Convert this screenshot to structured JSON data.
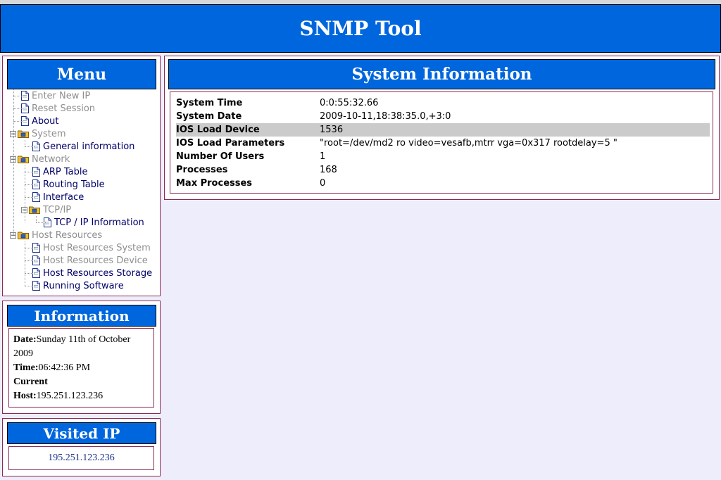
{
  "header": {
    "title": "SNMP Tool"
  },
  "menu": {
    "title": "Menu",
    "items": [
      {
        "label": "Enter New IP",
        "type": "doc",
        "depth": 0,
        "muted": true
      },
      {
        "label": "Reset Session",
        "type": "doc",
        "depth": 0,
        "muted": true
      },
      {
        "label": "About",
        "type": "doc",
        "depth": 0,
        "muted": false
      },
      {
        "label": "System",
        "type": "folder",
        "depth": 0,
        "muted": true
      },
      {
        "label": "General information",
        "type": "doc",
        "depth": 1,
        "muted": false
      },
      {
        "label": "Network",
        "type": "folder",
        "depth": 0,
        "muted": true
      },
      {
        "label": "ARP Table",
        "type": "doc",
        "depth": 1,
        "muted": false
      },
      {
        "label": "Routing Table",
        "type": "doc",
        "depth": 1,
        "muted": false
      },
      {
        "label": "Interface",
        "type": "doc",
        "depth": 1,
        "muted": false
      },
      {
        "label": "TCP/IP",
        "type": "folder",
        "depth": 1,
        "muted": true
      },
      {
        "label": "TCP / IP Information",
        "type": "doc",
        "depth": 2,
        "muted": false
      },
      {
        "label": "Host Resources",
        "type": "folder",
        "depth": 0,
        "muted": true
      },
      {
        "label": "Host Resources System",
        "type": "doc",
        "depth": 1,
        "muted": true
      },
      {
        "label": "Host Resources Device",
        "type": "doc",
        "depth": 1,
        "muted": true
      },
      {
        "label": "Host Resources Storage",
        "type": "doc",
        "depth": 1,
        "muted": false
      },
      {
        "label": "Running Software",
        "type": "doc",
        "depth": 1,
        "muted": false
      }
    ]
  },
  "info": {
    "title": "Information",
    "date_label": "Date:",
    "date_value": "Sunday 11th of October 2009",
    "time_label": "Time:",
    "time_value": "06:42:36 PM",
    "host_label_1": "Current",
    "host_label_2": "Host:",
    "host_value": "195.251.123.236"
  },
  "visited": {
    "title": "Visited IP",
    "ips": [
      "195.251.123.236"
    ]
  },
  "system_info": {
    "title": "System Information",
    "rows": [
      {
        "key": "System Time",
        "value": "0:0:55:32.66",
        "highlight": false
      },
      {
        "key": "System Date",
        "value": "2009-10-11,18:38:35.0,+3:0",
        "highlight": false
      },
      {
        "key": "IOS Load Device",
        "value": "1536",
        "highlight": true
      },
      {
        "key": "IOS Load Parameters",
        "value": "\"root=/dev/md2 ro video=vesafb,mtrr vga=0x317 rootdelay=5 \"",
        "highlight": false
      },
      {
        "key": "Number Of Users",
        "value": "1",
        "highlight": false
      },
      {
        "key": "Processes",
        "value": "168",
        "highlight": false
      },
      {
        "key": "Max Processes",
        "value": "0",
        "highlight": false
      }
    ]
  },
  "colors": {
    "accent": "#0066dd",
    "page_bg": "#eeedfb",
    "panel_border": "#8b2a50",
    "link": "#00006a",
    "muted": "#8e8e8e",
    "row_highlight": "#cbcbcb"
  },
  "icons": {
    "doc": "document-icon",
    "folder": "folder-icon",
    "toggle": "collapse-toggle-icon"
  }
}
